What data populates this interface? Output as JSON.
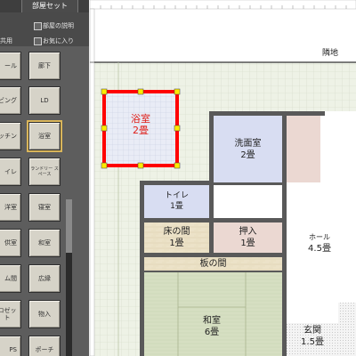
{
  "panel": {
    "tab_label": "部屋セット",
    "room_description_label": "部屋の説明",
    "common_label": "共用",
    "favorites_label": "お気に入り",
    "buttons": [
      "ール",
      "廊下",
      "ビング",
      "LD",
      "ッチン",
      "浴室",
      "イレ",
      "ランドリー スペース",
      "洋室",
      "寝室",
      "供室",
      "和室",
      "ム間",
      "広縁",
      "ロゼット",
      "物入",
      "PS",
      "ポーチ"
    ]
  },
  "plan": {
    "site_label": "隣地",
    "rooms": {
      "bath": {
        "name": "浴室",
        "size": "2畳"
      },
      "washroom": {
        "name": "洗面室",
        "size": "2畳"
      },
      "toilet": {
        "name": "トイレ",
        "size": "1畳"
      },
      "tokonoma": {
        "name": "床の間",
        "size": "1畳"
      },
      "oshiire": {
        "name": "押入",
        "size": "1畳"
      },
      "hall": {
        "name": "ホール",
        "size": "4.5畳"
      },
      "itanoma": {
        "name": "板の間"
      },
      "washitsu": {
        "name": "和室",
        "size": "6畳"
      },
      "genkan": {
        "name": "玄関",
        "size": "1.5畳"
      }
    }
  },
  "colors": {
    "selection": "#ff0000",
    "washroom_fill": "#d8ddf2",
    "hall_fill": "#ffffff",
    "wood_fill": "#ece2c8",
    "tatami_fill": "#d6dfc2",
    "pink_fill": "#ebd8d2",
    "wall": "#595959",
    "background": "#f1f4ec"
  }
}
